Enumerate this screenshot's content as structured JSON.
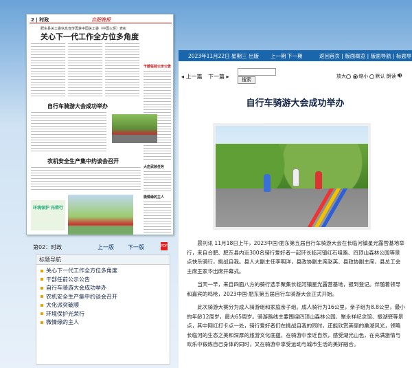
{
  "thumbnail": {
    "page_number": "2 | 时政",
    "brand": "合肥晚报",
    "kicker": "肥东县关工委信息宣传再获中国关工委（中国火炬）表彰",
    "headline": "关心下一代工作全方位多角度",
    "article1": "自行车骑游大会成功举办",
    "article2": "农机安全生产集中约谈会召开",
    "side1": "干部任前公示公告",
    "side2": "大庄武装任务",
    "side3": "微情缘的主人",
    "badge": "环境保护 光荣行"
  },
  "topbar": {
    "date": "2023年11月22日 星期三 出版",
    "prev": "上一期",
    "next": "下一期",
    "links": "返回首页 | 版面概览 | 版面导航 | 标题导航"
  },
  "pager": {
    "current": "第02：时政",
    "prev": "上一版",
    "next": "下一版",
    "pdf": "PDF"
  },
  "toc": {
    "title": "标题导航",
    "items": [
      "关心下一代工作全方位多角度",
      "干部任前公示公告",
      "自行车骑游大会成功举办",
      "农机安全生产集中约谈会召开",
      "大化派突破顺",
      "环境保护光荣行",
      "微情缘的主人"
    ]
  },
  "article_nav": {
    "prev": "上一篇",
    "next": "下一篇",
    "search_button": "搜索",
    "font_label": "放大",
    "font_options": [
      "缩小",
      "默认"
    ],
    "read_label": "朗读"
  },
  "article": {
    "title": "自行车骑游大会成功举办",
    "paragraphs": [
      "晨刊讯  11月18日上午，2023中国·肥东第五届自行车骑游大会在长临河镇星光露营基地举行，来自合肥、肥东县内近300名骑行爱好者一起环长临河镇红石咀路、四顶山森林公园等景点快乐骑行，挑战自我。县人大副主任李明洋，县政协副主席赵英、县政协副主席、县总工会主席王家华出席开幕式。",
      "当天一早，来自四面八方的骑行选手聚集长临河镇星光露营基地，报到登记。伴随着领导和嘉宾的鸣枪，2023中国·肥东第五届自行车骑游大会正式开始。",
      "此次骑游大赛分为成人骑游组和家庭亲子组。成人骑行为16公里，亲子组为8.8公里，最小的年龄12周岁，最大65周岁。骑游路线主要围绕四顶山森林公园、聚永祥纪念馆、振湖驿等景点，其中网红打卡点一处，骑行爱好者们在挑战自我的同时，还能欣赏美丽的巢湖风光，领略长临河的生态之美和深厚的旅游文化底蕴，在骑游中亲近自然，感受湖光山色，在充满激情与欢乐中锻炼自己身体的同时，又在骑游中享受运动与城市生活的美好融合。"
    ]
  },
  "colors": {
    "accent": "#1a66ad",
    "title": "#124",
    "bullet": "#e9a400"
  }
}
